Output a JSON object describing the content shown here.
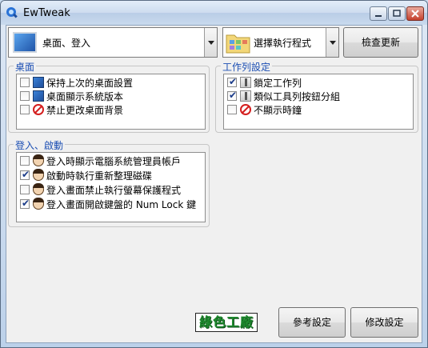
{
  "window": {
    "title": "EwTweak"
  },
  "top": {
    "combo1_value": "桌面、登入",
    "combo2_value": "選擇執行程式",
    "check_update_label": "檢查更新"
  },
  "groups": {
    "desktop": {
      "title": "桌面",
      "items": [
        {
          "label": "保持上次的桌面設置",
          "checked": false,
          "icon": "desktop-icon"
        },
        {
          "label": "桌面顯示系統版本",
          "checked": false,
          "icon": "desktop-icon"
        },
        {
          "label": "禁止更改桌面背景",
          "checked": false,
          "icon": "no-entry-icon"
        }
      ]
    },
    "taskbar": {
      "title": "工作列設定",
      "items": [
        {
          "label": "鎖定工作列",
          "checked": true,
          "icon": "taskbar-icon"
        },
        {
          "label": "類似工具列按鈕分組",
          "checked": true,
          "icon": "taskbar-icon"
        },
        {
          "label": "不顯示時鐘",
          "checked": false,
          "icon": "no-entry-icon"
        }
      ]
    },
    "login": {
      "title": "登入、啟動",
      "items": [
        {
          "label": "登入時顯示電腦系統管理員帳戶",
          "checked": false,
          "icon": "user-icon"
        },
        {
          "label": "啟動時執行重新整理磁碟",
          "checked": true,
          "icon": "user-icon"
        },
        {
          "label": "登入畫面禁止執行螢幕保護程式",
          "checked": false,
          "icon": "user-icon"
        },
        {
          "label": "登入畫面開啟鍵盤的 Num Lock 鍵",
          "checked": true,
          "icon": "user-icon"
        }
      ]
    }
  },
  "footer": {
    "logo_text": "綠色工廠",
    "reference_label": "參考設定",
    "apply_label": "修改設定"
  }
}
